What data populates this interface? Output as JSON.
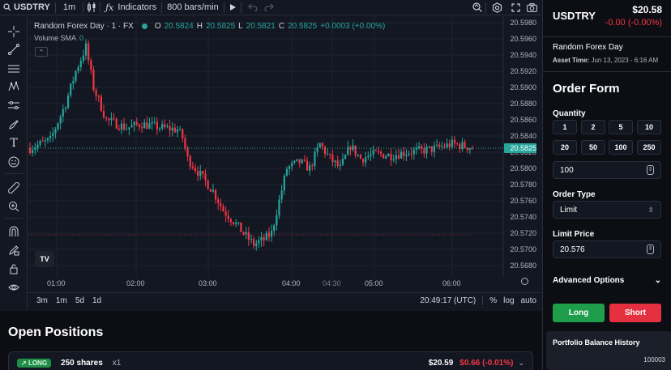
{
  "toolbar": {
    "symbol": "USDTRY",
    "interval": "1m",
    "indicators_label": "Indicators",
    "bars_label": "800 bars/min"
  },
  "legend": {
    "title": "Random Forex Day · 1 · FX",
    "o_label": "O",
    "o_value": "20.5824",
    "h_label": "H",
    "h_value": "20.5825",
    "l_label": "L",
    "l_value": "20.5821",
    "c_label": "C",
    "c_value": "20.5825",
    "change": "+0.0003 (+0.00%)",
    "volume_label": "Volume SMA",
    "volume_value": "0"
  },
  "chart_data": {
    "type": "candlestick",
    "price_ticks": [
      "20.5980",
      "20.5960",
      "20.5940",
      "20.5920",
      "20.5900",
      "20.5880",
      "20.5860",
      "20.5840",
      "20.5820",
      "20.5800",
      "20.5780",
      "20.5760",
      "20.5740",
      "20.5720",
      "20.5700",
      "20.5680"
    ],
    "last_price_label": "20.5825",
    "time_ticks": [
      "01:00",
      "02:00",
      "03:00",
      "04:00",
      "04:30",
      "05:00",
      "06:00"
    ],
    "ylim": [
      20.5675,
      20.5985
    ],
    "last_price": 20.5825,
    "trend_points": [
      [
        0,
        20.5825
      ],
      [
        8,
        20.5835
      ],
      [
        14,
        20.588
      ],
      [
        18,
        20.592
      ],
      [
        22,
        20.595
      ],
      [
        25,
        20.59
      ],
      [
        30,
        20.586
      ],
      [
        38,
        20.585
      ],
      [
        44,
        20.5855
      ],
      [
        52,
        20.585
      ],
      [
        58,
        20.5848
      ],
      [
        60,
        20.5838
      ],
      [
        62,
        20.5812
      ],
      [
        66,
        20.5796
      ],
      [
        72,
        20.5772
      ],
      [
        76,
        20.5748
      ],
      [
        80,
        20.5735
      ],
      [
        85,
        20.5716
      ],
      [
        88,
        20.5706
      ],
      [
        92,
        20.5712
      ],
      [
        95,
        20.572
      ],
      [
        98,
        20.576
      ],
      [
        101,
        20.58
      ],
      [
        106,
        20.5808
      ],
      [
        110,
        20.58
      ],
      [
        114,
        20.583
      ],
      [
        118,
        20.5812
      ],
      [
        122,
        20.58
      ],
      [
        126,
        20.5828
      ],
      [
        130,
        20.5812
      ],
      [
        136,
        20.5818
      ],
      [
        142,
        20.5816
      ],
      [
        148,
        20.582
      ],
      [
        154,
        20.5822
      ],
      [
        160,
        20.5825
      ],
      [
        166,
        20.583
      ],
      [
        170,
        20.5828
      ],
      [
        175,
        20.5825
      ]
    ],
    "grid": true
  },
  "bottombar": {
    "ranges": [
      "3m",
      "1m",
      "5d",
      "1d"
    ],
    "clock": "20:49:17 (UTC)",
    "percent": "%",
    "log": "log",
    "auto": "auto"
  },
  "positions": {
    "title": "Open Positions",
    "rows": [
      {
        "side": "LONG",
        "shares": "250 shares",
        "mult": "x1",
        "price": "$20.59",
        "pnl": "$0.66 (-0.01%)"
      }
    ]
  },
  "panel": {
    "symbol": "USDTRY",
    "price": "$20.58",
    "change": "-0.00 (-0.00%)",
    "name": "Random Forex Day",
    "time_label": "Asset Time:",
    "time_value": "Jun 13, 2023 - 6:16 AM",
    "order_title": "Order Form",
    "quantity_label": "Quantity",
    "quantity_presets": [
      "1",
      "2",
      "5",
      "10",
      "20",
      "50",
      "100",
      "250"
    ],
    "quantity_value": "100",
    "order_type_label": "Order Type",
    "order_type_value": "Limit",
    "limit_label": "Limit Price",
    "limit_value": "20.576",
    "advanced_label": "Advanced Options",
    "long_label": "Long",
    "short_label": "Short",
    "history_title": "Portfolio Balance History",
    "history_value": "100003"
  },
  "colors": {
    "up": "#26a69a",
    "down": "#f23645",
    "long_button": "#1e9e4a",
    "short_button": "#e5313f",
    "background": "#131722"
  }
}
